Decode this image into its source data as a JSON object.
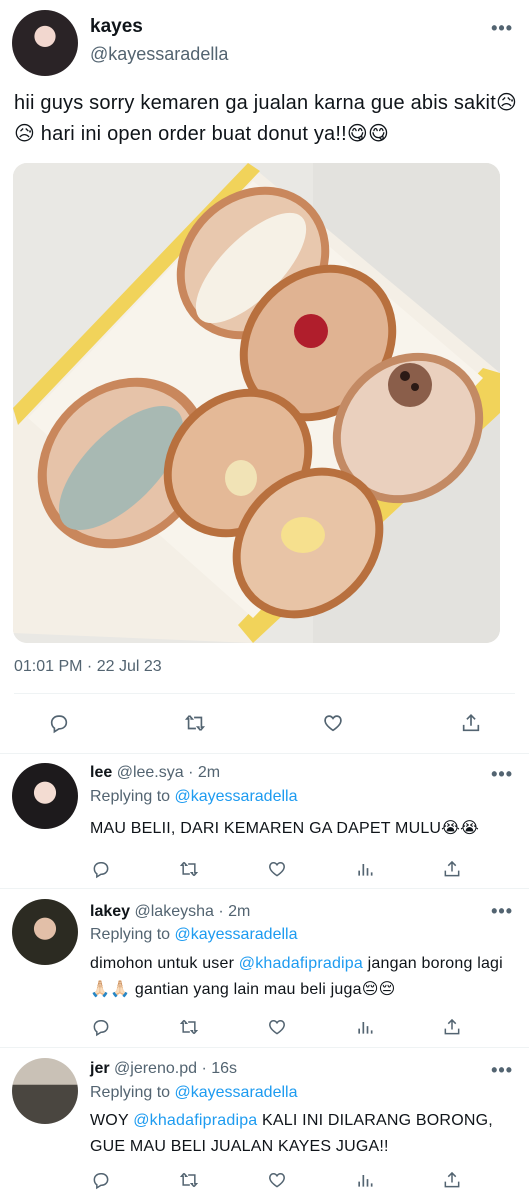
{
  "main_tweet": {
    "display_name": "kayes",
    "handle": "@kayessaradella",
    "text": "hii guys sorry kemaren ga jualan karna gue abis sakit😥😥 hari ini open order buat donut ya!!😋😋",
    "timestamp": "01:01 PM · 22 Jul 23",
    "more_icon": "more-dots-icon",
    "actions": [
      "reply-icon",
      "retweet-icon",
      "like-icon",
      "share-icon"
    ]
  },
  "replies": [
    {
      "display_name": "lee",
      "handle": "@lee.sya",
      "time": "2m",
      "replying_prefix": "Replying to ",
      "replying_to": "@kayessaradella",
      "text_parts": [
        "MAU BELII, DARI KEMAREN GA DAPET MULU😭😭"
      ]
    },
    {
      "display_name": "lakey",
      "handle": "@lakeysha",
      "time": "2m",
      "replying_prefix": "Replying to ",
      "replying_to": "@kayessaradella",
      "text_parts": [
        "dimohon untuk user ",
        "@khadafipradipa",
        " jangan borong lagi🙏🏻🙏🏻 gantian yang lain mau beli juga😔😔"
      ]
    },
    {
      "display_name": "jer",
      "handle": "@jereno.pd",
      "time": "16s",
      "replying_prefix": "Replying to ",
      "replying_to": "@kayessaradella",
      "text_parts": [
        "WOY ",
        "@khadafipradipa",
        " KALI INI DILARANG BORONG, GUE MAU BELI JUALAN KAYES JUGA!!"
      ]
    }
  ],
  "separator": "·",
  "colors": {
    "text": "#0f1419",
    "secondary": "#536471",
    "link": "#1d9bf0",
    "divider": "#eff3f4",
    "box_yellow": "#f1d35a"
  }
}
